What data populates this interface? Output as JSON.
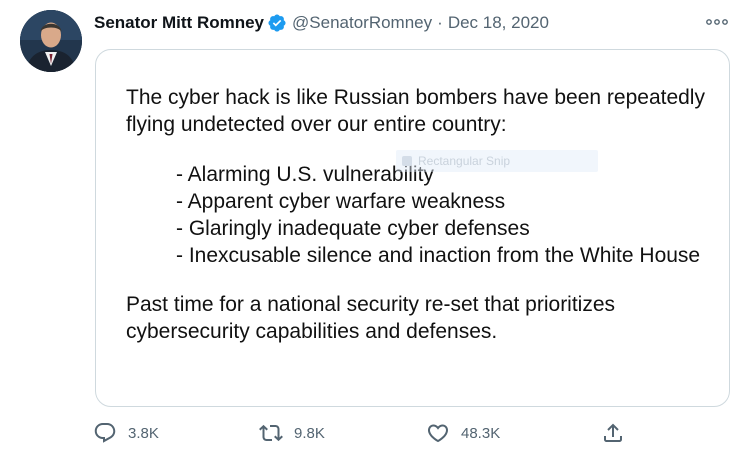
{
  "author": {
    "name": "Senator Mitt Romney",
    "handle": "@SenatorRomney",
    "separator": "·",
    "date": "Dec 18, 2020",
    "verified": true
  },
  "card": {
    "intro": "The cyber hack is like Russian bombers have been repeatedly flying undetected over our entire country:",
    "bullets": [
      "- Alarming U.S. vulnerability",
      "- Apparent cyber warfare weakness",
      "- Glaringly inadequate cyber defenses",
      "- Inexcusable silence and inaction from the White House"
    ],
    "conclusion": "Past time for a national security re-set that prioritizes cybersecurity capabilities and defenses.",
    "overlay_label": "Rectangular Snip"
  },
  "actions": {
    "reply": {
      "icon": "reply-icon",
      "count": "3.8K"
    },
    "retweet": {
      "icon": "retweet-icon",
      "count": "9.8K"
    },
    "like": {
      "icon": "heart-icon",
      "count": "48.3K"
    },
    "share": {
      "icon": "share-icon"
    }
  },
  "colors": {
    "text": "#0f1419",
    "secondary": "#536471",
    "verified": "#1d9bf0",
    "border": "#cfd9de"
  }
}
